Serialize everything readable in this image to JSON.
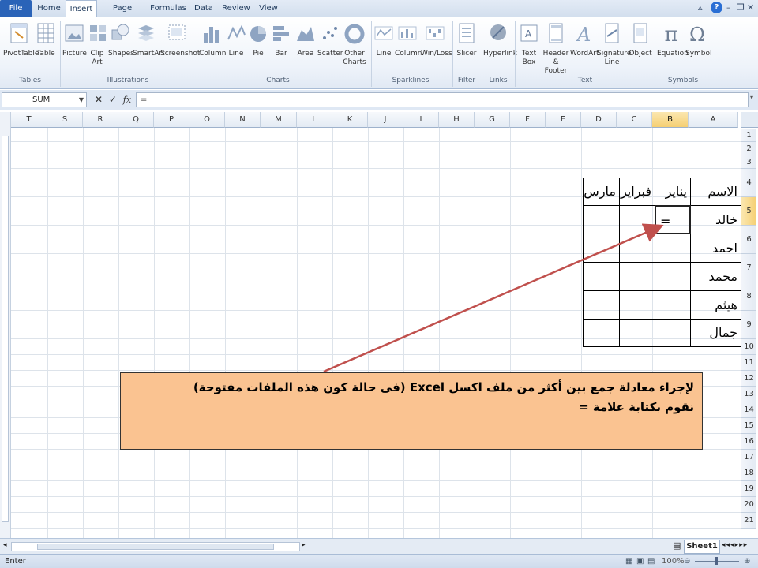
{
  "tabs": [
    "File",
    "Home",
    "Insert",
    "Page Layout",
    "Formulas",
    "Data",
    "Review",
    "View"
  ],
  "active_tab": "Insert",
  "ribbon": {
    "groups": [
      {
        "label": "Tables",
        "items": [
          "PivotTable",
          "Table"
        ]
      },
      {
        "label": "Illustrations",
        "items": [
          "Picture",
          "Clip Art",
          "Shapes",
          "SmartArt",
          "Screenshot"
        ]
      },
      {
        "label": "Charts",
        "items": [
          "Column",
          "Line",
          "Pie",
          "Bar",
          "Area",
          "Scatter",
          "Other Charts"
        ]
      },
      {
        "label": "Sparklines",
        "items": [
          "Line",
          "Column",
          "Win/Loss"
        ]
      },
      {
        "label": "Filter",
        "items": [
          "Slicer"
        ]
      },
      {
        "label": "Links",
        "items": [
          "Hyperlink"
        ]
      },
      {
        "label": "Text",
        "items": [
          "Text Box",
          "Header & Footer",
          "WordArt",
          "Signature Line",
          "Object"
        ]
      },
      {
        "label": "Symbols",
        "items": [
          "Equation",
          "Symbol"
        ]
      }
    ]
  },
  "formula_bar": {
    "name_box": "SUM",
    "fx": "fx",
    "content": "="
  },
  "columns": [
    "T",
    "S",
    "R",
    "Q",
    "P",
    "O",
    "N",
    "M",
    "L",
    "K",
    "J",
    "I",
    "H",
    "G",
    "F",
    "E",
    "D",
    "C",
    "B",
    "A"
  ],
  "selected_column": "B",
  "rows": [
    "1",
    "2",
    "3",
    "4",
    "5",
    "6",
    "7",
    "8",
    "9",
    "10",
    "11",
    "12",
    "13",
    "14",
    "15",
    "16",
    "17",
    "18",
    "19",
    "20",
    "21"
  ],
  "selected_row": "5",
  "table": {
    "headers": [
      "الاسم",
      "يناير",
      "فبراير",
      "مارس"
    ],
    "names": [
      "خالد",
      "احمد",
      "محمد",
      "هيثم",
      "جمال"
    ],
    "active_cell_value": "="
  },
  "callout": {
    "line1": "لإجراء معادلة جمع بين أكثر من ملف  اكسل Excel (فى حالة كون هذه الملفات مفتوحة)",
    "line2": "نقوم بكتابة علامة ="
  },
  "sheet_tab": "Sheet1",
  "status": {
    "mode": "Enter",
    "zoom": "100%"
  },
  "accent_color": "#c0504d",
  "callout_fill": "#fac391"
}
